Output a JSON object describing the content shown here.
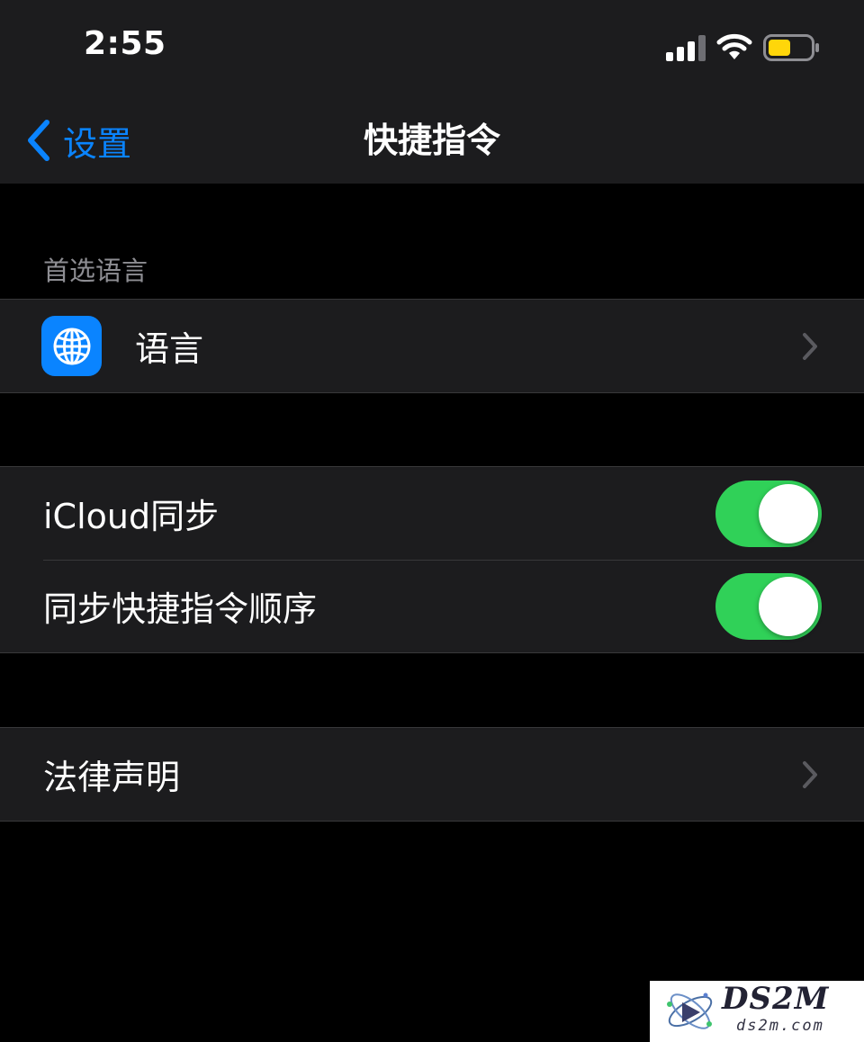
{
  "status_bar": {
    "time": "2:55",
    "signal_icon": "cellular-signal-icon",
    "wifi_icon": "wifi-icon",
    "battery_icon": "battery-low-power-icon",
    "battery_color": "#ffd60a"
  },
  "nav": {
    "back_label": "设置",
    "title": "快捷指令",
    "back_color": "#0a84ff"
  },
  "sections": {
    "language_header": "首选语言",
    "language_row": {
      "icon": "globe-icon",
      "icon_bg": "#0a84ff",
      "label": "语言"
    },
    "sync_rows": [
      {
        "label": "iCloud同步",
        "toggle_on": true
      },
      {
        "label": "同步快捷指令顺序",
        "toggle_on": true
      }
    ],
    "legal_row": {
      "label": "法律声明"
    }
  },
  "toggle_on_color": "#30d158",
  "watermark": {
    "title": "DS2M",
    "url": "ds2m.com"
  }
}
